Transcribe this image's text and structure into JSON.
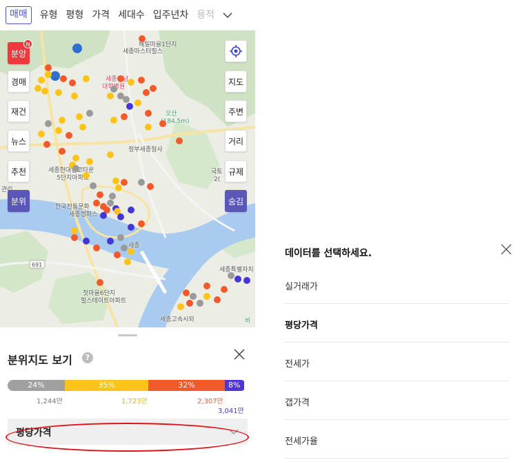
{
  "filter_bar": {
    "chips": [
      "매매",
      "유형",
      "평형",
      "가격",
      "세대수",
      "입주년차",
      "용적"
    ],
    "active_chip": 0,
    "more_icon": "chevron-down-icon"
  },
  "map": {
    "labels": {
      "place1": "해밀마을1단지",
      "place2": "세종마스터힐스",
      "univ": "세종충남",
      "univ2": "대학병원",
      "mountain": "오산",
      "mountain_height": "(184.5m)",
      "gov": "정부세종청사",
      "apt1": "세종현대엠코타운",
      "apt1b": "5단지아파트",
      "culture": "한국전통문화",
      "culture2": "세종캠퍼스",
      "sejong": "세종",
      "road": "691",
      "apt2": "첫마을6단지",
      "apt2b": "힐스테이트아파트",
      "terminal": "세종고속시외",
      "kukt": "국토",
      "num": "2(",
      "gwanri": "관리",
      "far_right": "세종특별자치",
      "bi": "비"
    },
    "left_buttons": [
      "분양",
      "경매",
      "재건",
      "뉴스",
      "추천",
      "분위"
    ],
    "new_badge": "N",
    "right_buttons": [
      "지도",
      "주변",
      "거리",
      "규제",
      "숨김"
    ],
    "locate_icon": "target-icon",
    "dot_colors": {
      "gray": "#9a9a9a",
      "yellow": "#fcc419",
      "orange": "#f25a2a",
      "purple": "#4536d6"
    }
  },
  "sheet": {
    "title": "분위지도 보기",
    "help_icon": "?",
    "segments": [
      {
        "percent": 24,
        "label": "24%",
        "color": "#a0a0a0"
      },
      {
        "percent": 35,
        "label": "35%",
        "color": "#fcc419"
      },
      {
        "percent": 32,
        "label": "32%",
        "color": "#f25a2a"
      },
      {
        "percent": 8,
        "label": "8%",
        "color": "#5134d4"
      }
    ],
    "values": [
      {
        "label": "1,244만",
        "color": "#777777"
      },
      {
        "label": "1,723만",
        "color": "#e8b400"
      },
      {
        "label": "2,307만",
        "color": "#f25a2a"
      },
      {
        "label": "3,041만",
        "color": "#4536d6"
      }
    ],
    "dropdown_label": "평당가격"
  },
  "select_panel": {
    "title": "데이터를 선택하세요.",
    "options": [
      "실거래가",
      "평당가격",
      "전세가",
      "갭가격",
      "전세가율"
    ],
    "selected": 1
  }
}
